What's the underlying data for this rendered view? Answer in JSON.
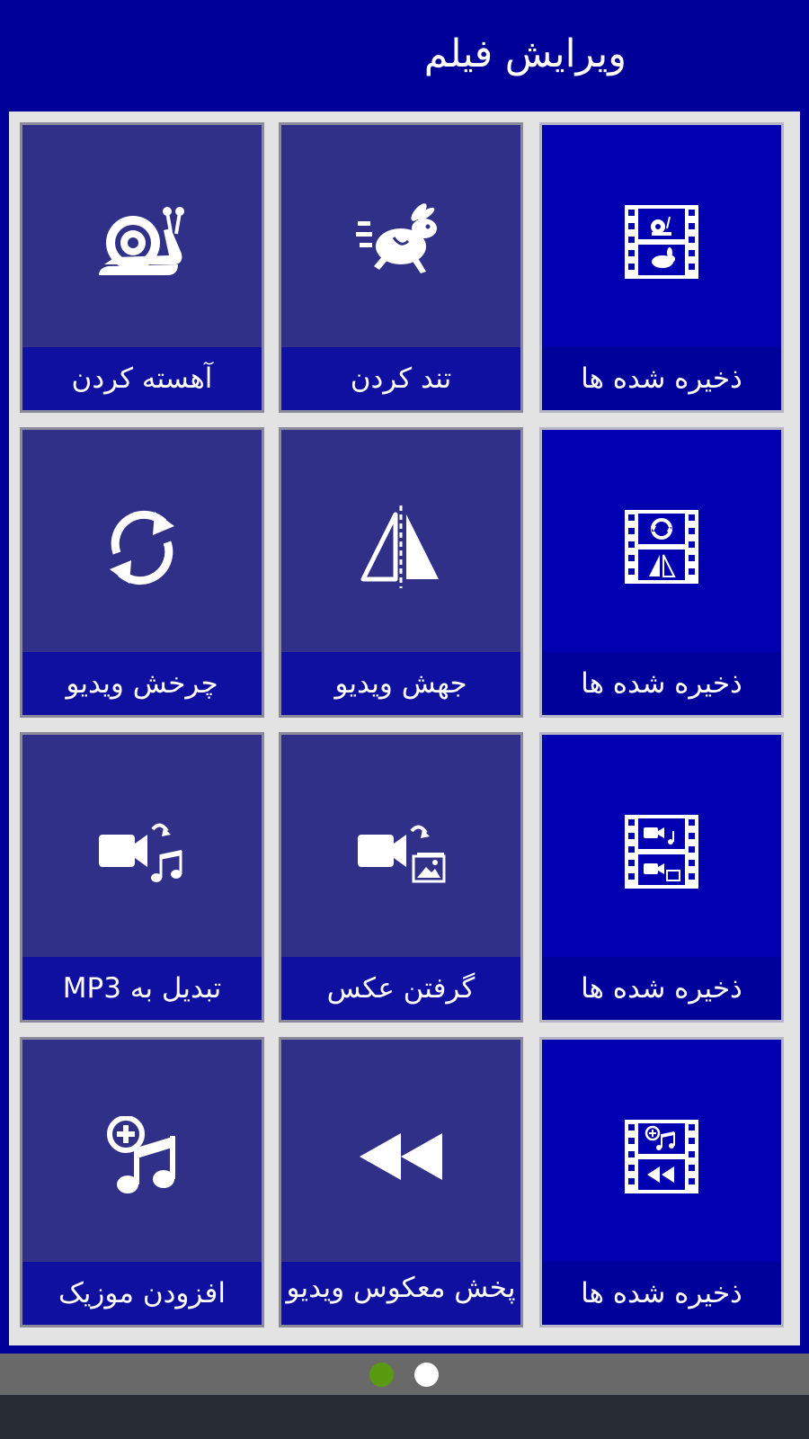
{
  "header": {
    "title": "ویرایش فیلم"
  },
  "tiles": [
    {
      "label": "ذخیره شده ها",
      "icon": "saved-slow-fast-film-icon"
    },
    {
      "label": "تند کردن",
      "icon": "running-rabbit-icon"
    },
    {
      "label": "آهسته کردن",
      "icon": "snail-icon"
    },
    {
      "label": "ذخیره شده ها",
      "icon": "saved-rotate-flip-film-icon"
    },
    {
      "label": "جهش ویدیو",
      "icon": "flip-icon"
    },
    {
      "label": "چرخش ویدیو",
      "icon": "rotate-icon"
    },
    {
      "label": "ذخیره شده ها",
      "icon": "saved-mp3-photo-film-icon"
    },
    {
      "label": "گرفتن عکس",
      "icon": "video-to-image-icon"
    },
    {
      "label": "تبدیل به MP3",
      "icon": "video-to-music-icon"
    },
    {
      "label": "ذخیره شده ها",
      "icon": "saved-music-reverse-film-icon"
    },
    {
      "label": "پخش معکوس ویدیو",
      "icon": "rewind-icon"
    },
    {
      "label": "افزودن موزیک",
      "icon": "add-music-icon"
    }
  ],
  "pager": {
    "page_count": 2,
    "active_page": 1
  },
  "colors": {
    "background": "#000099",
    "tool_tile": "#303088",
    "saved_tile": "#0000b0",
    "frame": "#e3e3e3",
    "active_dot": "#5a9a10"
  }
}
